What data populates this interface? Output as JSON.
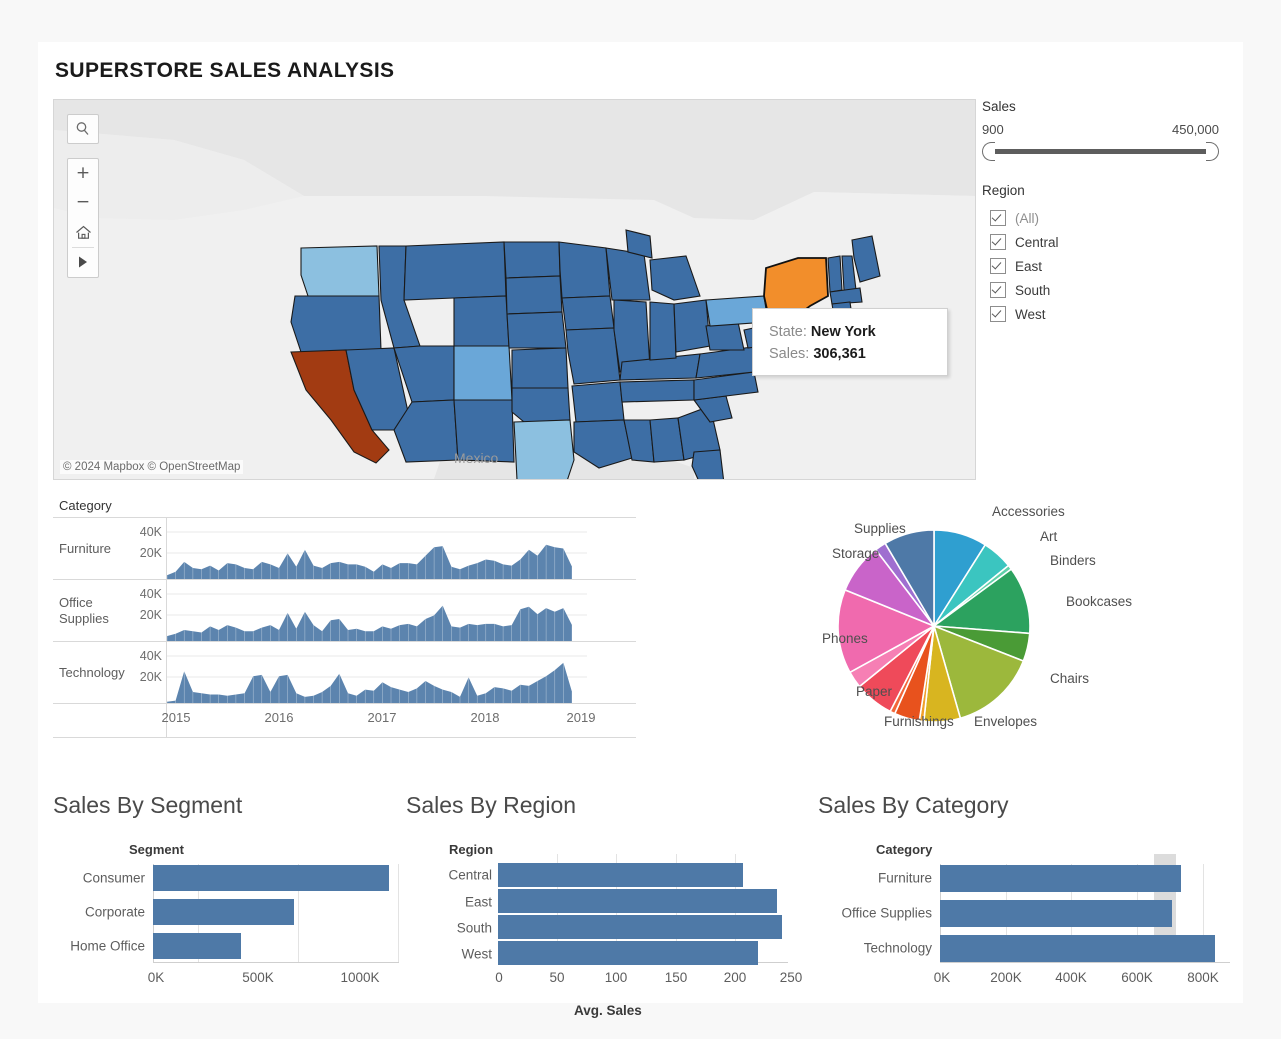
{
  "title": "SUPERSTORE SALES ANALYSIS",
  "map": {
    "controls": {
      "search": "search-icon",
      "zoom_in": "+",
      "zoom_out": "−",
      "home": "home-icon",
      "pan": "▶"
    },
    "attribution": "© 2024 Mapbox  © OpenStreetMap",
    "mexico_label": "Mexico",
    "tooltip": {
      "state_key": "State:",
      "state_value": "New York",
      "sales_key": "Sales:",
      "sales_value": "306,361"
    },
    "colors": {
      "highlight": "#f28e2b",
      "max_state": "#a23b12",
      "mid": "#3d6ea5",
      "light": "#8cc0e0",
      "land": "#e9e9e9"
    }
  },
  "filters": {
    "sales": {
      "title": "Sales",
      "min_label": "900",
      "max_label": "450,000"
    },
    "region": {
      "title": "Region",
      "options": [
        {
          "label": "(All)",
          "checked": true,
          "muted": true
        },
        {
          "label": "Central",
          "checked": true,
          "muted": false
        },
        {
          "label": "East",
          "checked": true,
          "muted": false
        },
        {
          "label": "South",
          "checked": true,
          "muted": false
        },
        {
          "label": "West",
          "checked": true,
          "muted": false
        }
      ]
    }
  },
  "chart_data": [
    {
      "type": "area",
      "name": "sales-trend-by-category",
      "header": "Category",
      "categories": [
        "Furniture",
        "Office Supplies",
        "Technology"
      ],
      "yticks": [
        "40K",
        "20K"
      ],
      "ylim": [
        0,
        50000
      ],
      "xlabel": "",
      "ylabel": "",
      "xticks": [
        "2015",
        "2016",
        "2017",
        "2018",
        "2019"
      ],
      "series": [
        {
          "name": "Furniture",
          "values": [
            3000,
            6000,
            14000,
            9000,
            8000,
            11000,
            7000,
            13000,
            12000,
            9000,
            8000,
            14000,
            12000,
            9000,
            21000,
            10000,
            24000,
            11000,
            9000,
            13000,
            14000,
            12000,
            12000,
            10000,
            6000,
            12000,
            9000,
            13000,
            13000,
            12000,
            19000,
            26000,
            27000,
            10000,
            8000,
            11000,
            13000,
            16000,
            15000,
            12000,
            11000,
            16000,
            24000,
            19000,
            28000,
            26000,
            25000,
            10000
          ]
        },
        {
          "name": "Office Supplies",
          "values": [
            4000,
            6000,
            9000,
            8000,
            7000,
            12000,
            9000,
            13000,
            11000,
            8000,
            8000,
            11000,
            13000,
            9000,
            23000,
            10000,
            24000,
            13000,
            8000,
            17000,
            18000,
            9000,
            10000,
            8000,
            8000,
            12000,
            10000,
            13000,
            14000,
            12000,
            18000,
            21000,
            29000,
            12000,
            11000,
            14000,
            13000,
            14000,
            14000,
            12000,
            13000,
            26000,
            28000,
            22000,
            27000,
            24000,
            27000,
            13000
          ]
        },
        {
          "name": "Technology",
          "values": [
            1000,
            2000,
            26000,
            9000,
            8000,
            7000,
            7000,
            6000,
            7000,
            8000,
            22000,
            23000,
            9000,
            22000,
            23000,
            8000,
            5000,
            6000,
            9000,
            14000,
            24000,
            8000,
            6000,
            11000,
            10000,
            17000,
            13000,
            11000,
            9000,
            12000,
            18000,
            14000,
            11000,
            9000,
            5000,
            21000,
            6000,
            8000,
            13000,
            12000,
            10000,
            15000,
            14000,
            18000,
            22000,
            27000,
            33000,
            9000
          ]
        }
      ]
    },
    {
      "type": "pie",
      "name": "sales-by-subcategory",
      "title": "",
      "labels": [
        "Accessories",
        "Art",
        "Binders",
        "Bookcases",
        "Chairs",
        "Envelopes",
        "Furnishings",
        "Paper",
        "Phones",
        "Storage",
        "Supplies"
      ],
      "values": [
        9.5,
        5.5,
        12.5,
        5.0,
        15.5,
        1.0,
        7.0,
        3.0,
        15.0,
        9.0,
        2.0
      ],
      "colors": [
        "#2f9fd0",
        "#3bc5c0",
        "#2ca25f",
        "#4a9b36",
        "#9cb83c",
        "#d8b520",
        "#e8521d",
        "#ef4a5a",
        "#f06aae",
        "#c964c9",
        "#9f6fd0"
      ],
      "extra_colors": [
        "#4e79a7",
        "#6aa7d8"
      ]
    },
    {
      "type": "bar",
      "name": "sales-by-segment",
      "title": "Sales By Segment",
      "axis_title": "Segment",
      "categories": [
        "Consumer",
        "Corporate",
        "Home Office"
      ],
      "values": [
        1150,
        690,
        430
      ],
      "xticks": [
        "0K",
        "500K",
        "1000K"
      ],
      "xlim": [
        0,
        1200
      ],
      "ylabel": "",
      "xlabel": ""
    },
    {
      "type": "bar",
      "name": "sales-by-region",
      "title": "Sales By Region",
      "axis_title": "Region",
      "categories": [
        "Central",
        "East",
        "South",
        "West"
      ],
      "values": [
        220,
        250,
        255,
        233
      ],
      "xticks": [
        "0",
        "50",
        "100",
        "150",
        "200",
        "250"
      ],
      "xlim": [
        0,
        260
      ],
      "xlabel": "Avg. Sales",
      "ylabel": ""
    },
    {
      "type": "bar",
      "name": "sales-by-category",
      "title": "Sales By Category",
      "axis_title": "Category",
      "categories": [
        "Furniture",
        "Office Supplies",
        "Technology"
      ],
      "values": [
        730,
        705,
        835
      ],
      "xticks": [
        "0K",
        "200K",
        "400K",
        "600K",
        "800K"
      ],
      "xlim": [
        0,
        880
      ],
      "ylabel": "",
      "xlabel": ""
    }
  ]
}
